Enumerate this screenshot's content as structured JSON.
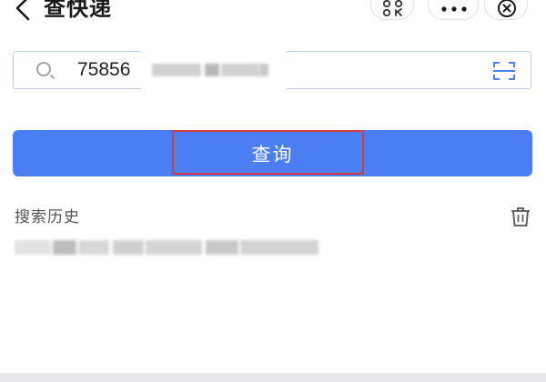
{
  "header": {
    "title": "查快递",
    "back_icon": "chevron-left-icon",
    "capsule_icons": [
      "qr-scan-icon",
      "more-icon",
      "close-icon"
    ]
  },
  "search": {
    "value": "75856",
    "value_obscured": true,
    "search_icon": "search-icon",
    "scan_icon": "scan-icon"
  },
  "query_button": {
    "label": "查询",
    "color": "#4a7ef2",
    "highlighted": true,
    "highlight_color": "#d33a3a"
  },
  "history": {
    "label": "搜索历史",
    "delete_icon": "trash-icon",
    "items_obscured": true
  }
}
